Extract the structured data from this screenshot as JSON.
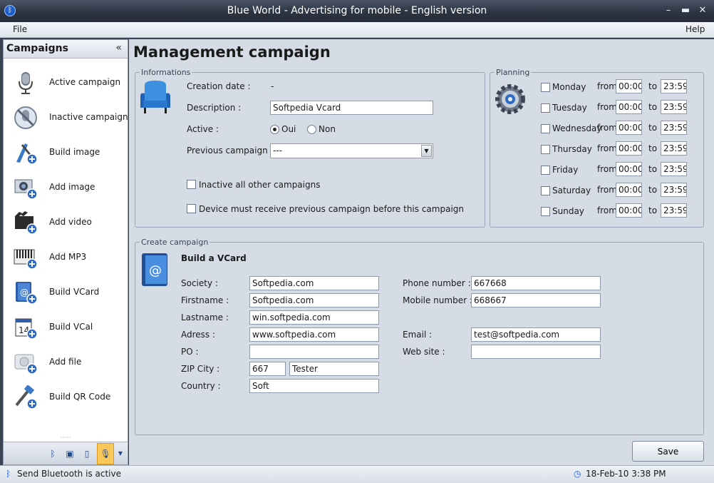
{
  "window": {
    "title": "Blue World - Advertising for mobile - English version",
    "minimize": "–",
    "maximize": "▬",
    "close": "✕"
  },
  "menu": {
    "file": "File",
    "help": "Help"
  },
  "sidebar": {
    "title": "Campaigns",
    "collapse": "«",
    "items": [
      {
        "label": "Active campaign",
        "icon": "microphone-icon"
      },
      {
        "label": "Inactive campaign",
        "icon": "microphone-off-icon"
      },
      {
        "label": "Build image",
        "icon": "build-image-icon"
      },
      {
        "label": "Add image",
        "icon": "add-image-icon"
      },
      {
        "label": "Add video",
        "icon": "add-video-icon"
      },
      {
        "label": "Add MP3",
        "icon": "add-mp3-icon"
      },
      {
        "label": "Build VCard",
        "icon": "build-vcard-icon"
      },
      {
        "label": "Build VCal",
        "icon": "build-vcal-icon"
      },
      {
        "label": "Add file",
        "icon": "add-file-icon"
      },
      {
        "label": "Build QR Code",
        "icon": "build-qr-icon"
      }
    ],
    "grip": "······",
    "bottom_tools": [
      "bluetooth-icon",
      "screen-icon",
      "phone-icon",
      "microphone-icon",
      "dropdown-icon"
    ]
  },
  "main": {
    "title": "Management campaign",
    "informations": {
      "legend": "Informations",
      "creation_date_label": "Creation date :",
      "creation_date_value": "-",
      "description_label": "Description :",
      "description_value": "Softpedia Vcard",
      "active_label": "Active :",
      "active_oui": "Oui",
      "active_non": "Non",
      "active_selected": "Oui",
      "previous_label": "Previous campaign :",
      "previous_value": "---",
      "inactive_all_label": "Inactive all other campaigns",
      "device_must_label": "Device must receive previous campaign before this campaign"
    },
    "planning": {
      "legend": "Planning",
      "from_label": "from",
      "to_label": "to",
      "days": [
        {
          "day": "Monday",
          "from": "00:00",
          "to": "23:59"
        },
        {
          "day": "Tuesday",
          "from": "00:00",
          "to": "23:59"
        },
        {
          "day": "Wednesday",
          "from": "00:00",
          "to": "23:59"
        },
        {
          "day": "Thursday",
          "from": "00:00",
          "to": "23:59"
        },
        {
          "day": "Friday",
          "from": "00:00",
          "to": "23:59"
        },
        {
          "day": "Saturday",
          "from": "00:00",
          "to": "23:59"
        },
        {
          "day": "Sunday",
          "from": "00:00",
          "to": "23:59"
        }
      ]
    },
    "create": {
      "legend": "Create campaign",
      "heading": "Build a VCard",
      "fields": {
        "society_label": "Society :",
        "society": "Softpedia.com",
        "firstname_label": "Firstname :",
        "firstname": "Softpedia.com",
        "lastname_label": "Lastname :",
        "lastname": "win.softpedia.com",
        "adress_label": "Adress :",
        "adress": "www.softpedia.com",
        "po_label": "PO :",
        "po": "",
        "zip_label": "ZIP City :",
        "zip": "667",
        "city": "Tester",
        "country_label": "Country :",
        "country": "Soft",
        "phone_label": "Phone number :",
        "phone": "667668",
        "mobile_label": "Mobile number :",
        "mobile": "668667",
        "email_label": "Email :",
        "email": "test@softpedia.com",
        "website_label": "Web site :",
        "website": ""
      }
    },
    "save_button": "Save"
  },
  "status": {
    "message": "Send Bluetooth is active",
    "datetime": "18-Feb-10 3:38 PM"
  },
  "colors": {
    "titlebar": "#2c3441",
    "panel": "#d6dce6",
    "accent": "#1d5fc9"
  }
}
